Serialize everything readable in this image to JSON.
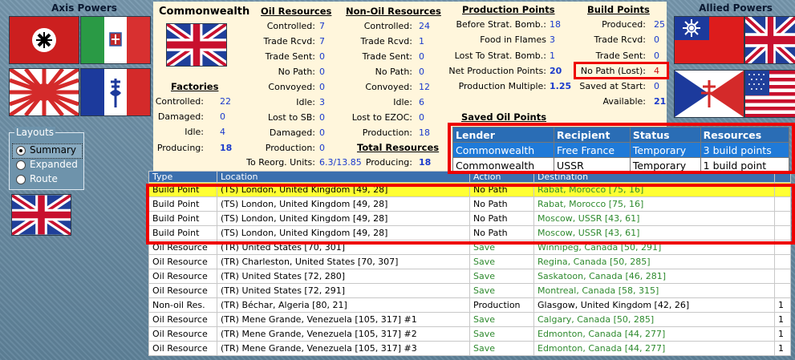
{
  "left": {
    "axis_title": "Axis Powers"
  },
  "right": {
    "allied_title": "Allied Powers"
  },
  "layouts": {
    "legend": "Layouts",
    "options": [
      "Summary",
      "Expanded",
      "Route"
    ],
    "selected": "Summary"
  },
  "country": {
    "name": "Commonwealth"
  },
  "factories": {
    "header": "Factories",
    "rows": [
      {
        "label": "Controlled:",
        "value": "22"
      },
      {
        "label": "Damaged:",
        "value": "0"
      },
      {
        "label": "Idle:",
        "value": "4"
      },
      {
        "label": "Producing:",
        "value": "18"
      }
    ]
  },
  "oil": {
    "header": "Oil Resources",
    "rows": [
      {
        "label": "Controlled:",
        "value": "7"
      },
      {
        "label": "Trade Rcvd:",
        "value": "7"
      },
      {
        "label": "Trade Sent:",
        "value": "0"
      },
      {
        "label": "No Path:",
        "value": "0"
      },
      {
        "label": "Convoyed:",
        "value": "0"
      },
      {
        "label": "Idle:",
        "value": "3"
      },
      {
        "label": "Lost to SB:",
        "value": "0"
      },
      {
        "label": "Damaged:",
        "value": "0"
      },
      {
        "label": "Production:",
        "value": "0"
      }
    ],
    "reorg_label": "To Reorg. Units:",
    "reorg_value": "6.3/13.85"
  },
  "nonoil": {
    "header": "Non-Oil Resources",
    "rows": [
      {
        "label": "Controlled:",
        "value": "24"
      },
      {
        "label": "Trade Rcvd:",
        "value": "1"
      },
      {
        "label": "Trade Sent:",
        "value": "0"
      },
      {
        "label": "No Path:",
        "value": "0"
      },
      {
        "label": "Convoyed:",
        "value": "12"
      },
      {
        "label": "Idle:",
        "value": "6"
      },
      {
        "label": "Lost to EZOC:",
        "value": "0"
      },
      {
        "label": "Production:",
        "value": "18"
      }
    ]
  },
  "total": {
    "header": "Total Resources",
    "label": "Producing:",
    "value": "18"
  },
  "production": {
    "header": "Production Points",
    "rows": [
      {
        "label": "Before Strat. Bomb.:",
        "value": "18"
      },
      {
        "label": "Food in Flames",
        "value": "3"
      },
      {
        "label": "Lost To Strat. Bomb.:",
        "value": "1"
      },
      {
        "label": "Net Production Points:",
        "value": "20"
      },
      {
        "label": "Production Multiple:",
        "value": "1.25"
      }
    ]
  },
  "build": {
    "header": "Build Points",
    "rows": [
      {
        "label": "Produced:",
        "value": "25"
      },
      {
        "label": "Trade Rcvd:",
        "value": "0"
      },
      {
        "label": "Trade Sent:",
        "value": "0"
      },
      {
        "label": "No Path (Lost):",
        "value": "4"
      },
      {
        "label": "Saved at Start:",
        "value": "0"
      },
      {
        "label": "Available:",
        "value": "21"
      }
    ]
  },
  "saved_oil": {
    "header": "Saved Oil Points"
  },
  "lender_table": {
    "headers": [
      "Lender",
      "Recipient",
      "Status",
      "Resources"
    ],
    "rows": [
      [
        "Commonwealth",
        "Free France",
        "Temporary",
        "3 build points"
      ],
      [
        "Commonwealth",
        "USSR",
        "Temporary",
        "1 build point"
      ]
    ]
  },
  "main_table": {
    "headers": [
      "Type",
      "Location",
      "Action",
      "Destination",
      ""
    ],
    "rows": [
      {
        "type": "Build Point",
        "location": "(TS) London, United Kingdom [49, 28]",
        "action": "No Path",
        "destination": "Rabat, Morocco [75, 16]",
        "extra": ""
      },
      {
        "type": "Build Point",
        "location": "(TS) London, United Kingdom [49, 28]",
        "action": "No Path",
        "destination": "Rabat, Morocco [75, 16]",
        "extra": ""
      },
      {
        "type": "Build Point",
        "location": "(TS) London, United Kingdom [49, 28]",
        "action": "No Path",
        "destination": "Moscow, USSR [43, 61]",
        "extra": ""
      },
      {
        "type": "Build Point",
        "location": "(TS) London, United Kingdom [49, 28]",
        "action": "No Path",
        "destination": "Moscow, USSR [43, 61]",
        "extra": ""
      },
      {
        "type": "Oil Resource",
        "location": "(TR) United States [70, 301]",
        "action": "Save",
        "destination": "Winnipeg, Canada [50, 291]",
        "extra": ""
      },
      {
        "type": "Oil Resource",
        "location": "(TR) Charleston, United States [70, 307]",
        "action": "Save",
        "destination": "Regina, Canada [50, 285]",
        "extra": ""
      },
      {
        "type": "Oil Resource",
        "location": "(TR) United States [72, 280]",
        "action": "Save",
        "destination": "Saskatoon, Canada [46, 281]",
        "extra": ""
      },
      {
        "type": "Oil Resource",
        "location": "(TR) United States [72, 291]",
        "action": "Save",
        "destination": "Montreal, Canada [58, 315]",
        "extra": ""
      },
      {
        "type": "Non-oil Res.",
        "location": "(TR) Béchar, Algeria [80, 21]",
        "action": "Production",
        "destination": "Glasgow, United Kingdom [42, 26]",
        "extra": "1"
      },
      {
        "type": "Oil Resource",
        "location": "(TR) Mene Grande, Venezuela [105, 317] #1",
        "action": "Save",
        "destination": "Calgary, Canada [50, 285]",
        "extra": "1"
      },
      {
        "type": "Oil Resource",
        "location": "(TR) Mene Grande, Venezuela [105, 317] #2",
        "action": "Save",
        "destination": "Edmonton, Canada [44, 277]",
        "extra": "1"
      },
      {
        "type": "Oil Resource",
        "location": "(TR) Mene Grande, Venezuela [105, 317] #3",
        "action": "Save",
        "destination": "Edmonton, Canada [44, 277]",
        "extra": "1"
      }
    ]
  },
  "colors": {
    "value_blue": "#1a3acc",
    "highlight_yellow": "#ffff33",
    "annotation_red": "#ee0000",
    "save_green": "#2e8a2e",
    "header_blue": "#2a6db5"
  }
}
